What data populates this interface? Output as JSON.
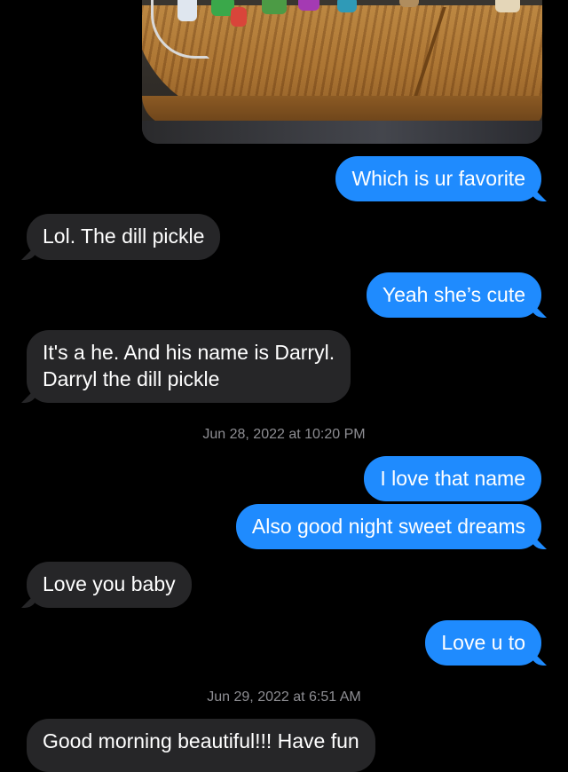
{
  "thread": {
    "messages": [
      {
        "text": "Which is ur favorite"
      },
      {
        "text": "Lol.  The dill pickle"
      },
      {
        "text": "Yeah she’s cute"
      },
      {
        "text": "It's a he.   And his name is Darryl.",
        "text2": "Darryl the dill pickle"
      },
      {
        "text": "I love that name"
      },
      {
        "text": "Also good night sweet dreams"
      },
      {
        "text": "Love you baby"
      },
      {
        "text": "Love u to"
      },
      {
        "text": "Good morning beautiful!!!   Have fun"
      }
    ],
    "timestamps": [
      {
        "text": "Jun 28, 2022 at 10:20 PM"
      },
      {
        "text": "Jun 29, 2022 at 6:51 AM"
      }
    ]
  },
  "colors": {
    "outgoing": "#1f8bfe",
    "incoming": "#262628",
    "background": "#000000"
  }
}
